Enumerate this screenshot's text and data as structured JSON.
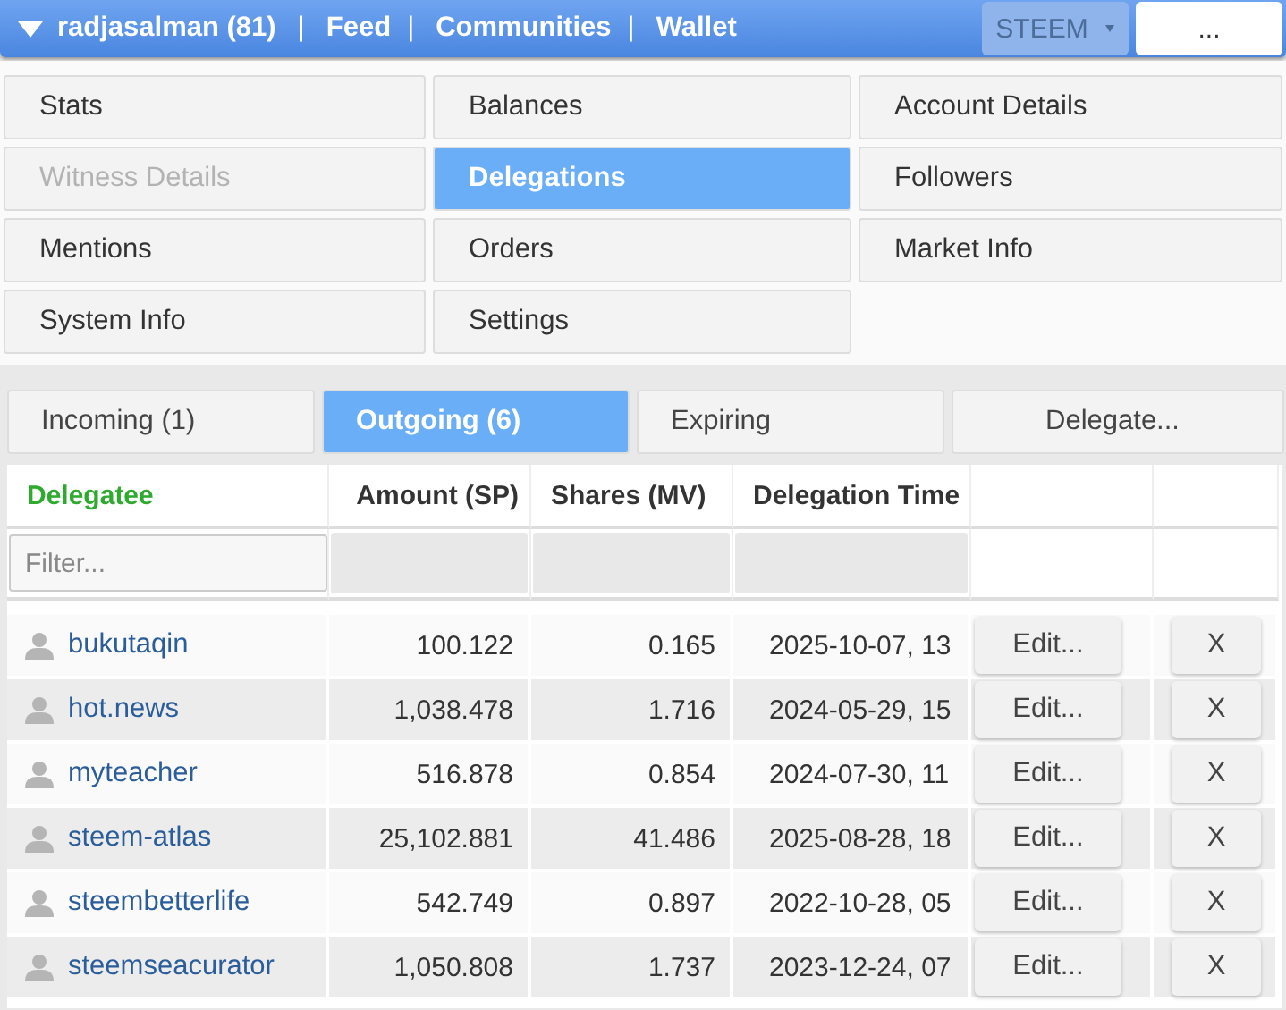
{
  "header": {
    "items": [
      {
        "kind": "user",
        "label": "radjasalman (81)"
      },
      {
        "kind": "sep",
        "label": "|"
      },
      {
        "kind": "link",
        "label": "Feed"
      },
      {
        "kind": "sep",
        "label": "|"
      },
      {
        "kind": "link",
        "label": "Communities"
      },
      {
        "kind": "sep",
        "label": "|"
      },
      {
        "kind": "link",
        "label": "Wallet"
      }
    ],
    "currency": "STEEM",
    "more": "..."
  },
  "menu": [
    {
      "label": "Stats",
      "selected": false,
      "disabled": false
    },
    {
      "label": "Balances",
      "selected": false,
      "disabled": false
    },
    {
      "label": "Account Details",
      "selected": false,
      "disabled": false
    },
    {
      "label": "Witness Details",
      "selected": false,
      "disabled": true
    },
    {
      "label": "Delegations",
      "selected": true,
      "disabled": false
    },
    {
      "label": "Followers",
      "selected": false,
      "disabled": false
    },
    {
      "label": "Mentions",
      "selected": false,
      "disabled": false
    },
    {
      "label": "Orders",
      "selected": false,
      "disabled": false
    },
    {
      "label": "Market Info",
      "selected": false,
      "disabled": false
    },
    {
      "label": "System Info",
      "selected": false,
      "disabled": false
    },
    {
      "label": "Settings",
      "selected": false,
      "disabled": false
    }
  ],
  "tabs": [
    {
      "label": "Incoming (1)",
      "selected": false
    },
    {
      "label": "Outgoing (6)",
      "selected": true
    },
    {
      "label": "Expiring",
      "selected": false
    },
    {
      "label": "Delegate...",
      "selected": false
    }
  ],
  "table": {
    "columns": [
      {
        "label": "Delegatee",
        "sorted": true
      },
      {
        "label": "Amount (SP)",
        "sorted": false
      },
      {
        "label": "Shares (MV)",
        "sorted": false
      },
      {
        "label": "Delegation Time",
        "sorted": false
      }
    ],
    "filter": {
      "placeholder": "Filter..."
    },
    "rows": [
      {
        "delegatee": "bukutaqin",
        "amount": "100.122",
        "shares": "0.165",
        "time": "2025-10-07, 13",
        "edit": "Edit...",
        "remove": "X"
      },
      {
        "delegatee": "hot.news",
        "amount": "1,038.478",
        "shares": "1.716",
        "time": "2024-05-29, 15",
        "edit": "Edit...",
        "remove": "X"
      },
      {
        "delegatee": "myteacher",
        "amount": "516.878",
        "shares": "0.854",
        "time": "2024-07-30, 11",
        "edit": "Edit...",
        "remove": "X"
      },
      {
        "delegatee": "steem-atlas",
        "amount": "25,102.881",
        "shares": "41.486",
        "time": "2025-08-28, 18",
        "edit": "Edit...",
        "remove": "X"
      },
      {
        "delegatee": "steembetterlife",
        "amount": "542.749",
        "shares": "0.897",
        "time": "2022-10-28, 05",
        "edit": "Edit...",
        "remove": "X"
      },
      {
        "delegatee": "steemseacurator",
        "amount": "1,050.808",
        "shares": "1.737",
        "time": "2023-12-24, 07",
        "edit": "Edit...",
        "remove": "X"
      }
    ]
  }
}
